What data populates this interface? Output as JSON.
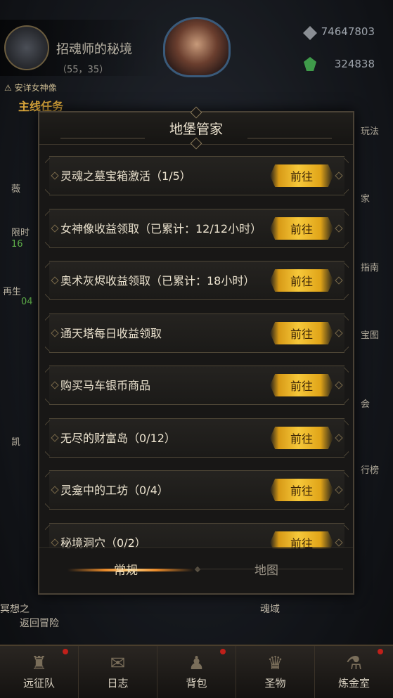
{
  "scene": {
    "location_name": "招魂师的秘境",
    "location_coords": "（55，35）",
    "hint": "安详女神像",
    "mainline": "主线任务",
    "resource_1": "74647803",
    "resource_2": "324838",
    "left_labels": [
      "薇",
      "限时",
      "16",
      "再生",
      "04",
      "凯"
    ],
    "right_labels": [
      "玩法",
      "家",
      "指南",
      "宝图",
      "会",
      "行榜"
    ],
    "bottom_left": "冥想之",
    "bottom_left_2": "返回冒险",
    "bottom_center": "魂域"
  },
  "modal": {
    "title": "地堡管家",
    "tasks": [
      {
        "text": "灵魂之墓宝箱激活（1/5）",
        "button": "前往"
      },
      {
        "text": "女神像收益领取（已累计：12/12小时）",
        "button": "前往"
      },
      {
        "text": "奥术灰烬收益领取（已累计：18小时）",
        "button": "前往"
      },
      {
        "text": "通天塔每日收益领取",
        "button": "前往"
      },
      {
        "text": "购买马车银币商品",
        "button": "前往"
      },
      {
        "text": "无尽的财富岛（0/12）",
        "button": "前往"
      },
      {
        "text": "灵龛中的工坊（0/4）",
        "button": "前往"
      },
      {
        "text": "秘境洞穴（0/2）",
        "button": "前往"
      }
    ],
    "tabs": {
      "normal": "常规",
      "map": "地图"
    }
  },
  "bottom_nav": [
    {
      "label": "远征队",
      "icon": "helmet-icon"
    },
    {
      "label": "日志",
      "icon": "scroll-icon"
    },
    {
      "label": "背包",
      "icon": "bag-icon"
    },
    {
      "label": "圣物",
      "icon": "relic-icon"
    },
    {
      "label": "炼金室",
      "icon": "alchemy-icon"
    }
  ],
  "colors": {
    "button_gold": "#f6c83a",
    "title_text": "#efe6d2",
    "mainline_gold": "#d8a53a",
    "notification_red": "#c0201a"
  }
}
